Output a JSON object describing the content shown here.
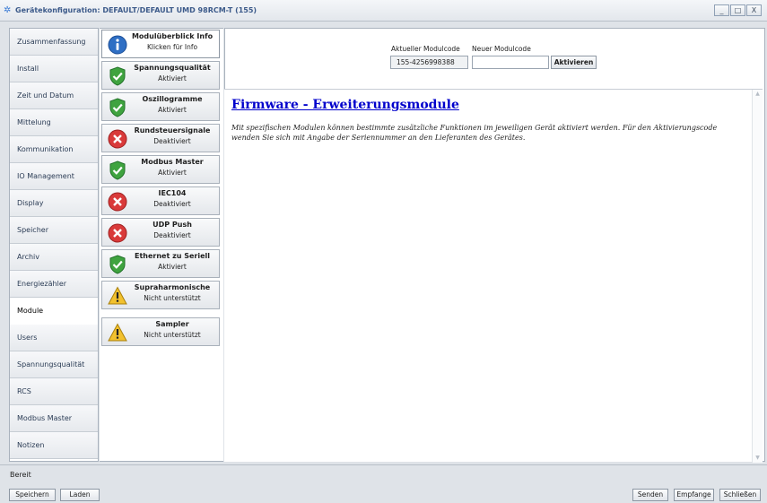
{
  "window": {
    "title": "Gerätekonfiguration: DEFAULT/DEFAULT    UMD 98RCM-T (155)",
    "buttons": [
      "_",
      "□",
      "X"
    ]
  },
  "nav": {
    "items": [
      "Zusammenfassung",
      "Install",
      "Zeit und Datum",
      "Mittelung",
      "Kommunikation",
      "IO Management",
      "Display",
      "Speicher",
      "Archiv",
      "Energiezähler",
      "Module",
      "Users",
      "Spannungsqualität",
      "RCS",
      "Modbus Master",
      "Notizen"
    ],
    "active_index": 10
  },
  "modules": [
    {
      "title": "Modulüberblick Info",
      "status": "Klicken für Info",
      "icon": "info-icon"
    },
    {
      "title": "Spannungsqualität",
      "status": "Aktiviert",
      "icon": "shield-check-icon"
    },
    {
      "title": "Oszillogramme",
      "status": "Aktiviert",
      "icon": "shield-check-icon"
    },
    {
      "title": "Rundsteuersignale",
      "status": "Deaktiviert",
      "icon": "error-x-icon"
    },
    {
      "title": "Modbus Master",
      "status": "Aktiviert",
      "icon": "shield-check-icon"
    },
    {
      "title": "IEC104",
      "status": "Deaktiviert",
      "icon": "error-x-icon"
    },
    {
      "title": "UDP Push",
      "status": "Deaktiviert",
      "icon": "error-x-icon"
    },
    {
      "title": "Ethernet zu Seriell",
      "status": "Aktiviert",
      "icon": "shield-check-icon"
    },
    {
      "title": "Supraharmonische",
      "status": "Nicht unterstützt",
      "icon": "warning-icon"
    },
    {
      "title": "Sampler",
      "status": "Nicht unterstützt",
      "icon": "warning-icon"
    }
  ],
  "code": {
    "current_label": "Aktueller Modulcode",
    "current_value": "155-4256998388",
    "new_label": "Neuer Modulcode",
    "new_value": "",
    "activate_label": "Aktivieren"
  },
  "doc": {
    "title": "Firmware - Erweiterungsmodule",
    "text": "Mit spezifischen Modulen können bestimmte zusätzliche Funktionen im jeweiligen Gerät aktiviert werden. Für den Aktivierungscode wenden Sie sich mit Angabe der Seriennummer an den Lieferanten des Gerätes."
  },
  "status": {
    "text": "Bereit",
    "save": "Speichern",
    "load": "Laden",
    "send": "Senden",
    "receive": "Empfange",
    "close": "Schließen"
  },
  "colors": {
    "link_blue": "#0000cc",
    "ok_green": "#3fa33f",
    "error_red": "#d93a3a",
    "warn_yellow": "#f2c12e",
    "info_blue": "#2f6fc4"
  }
}
